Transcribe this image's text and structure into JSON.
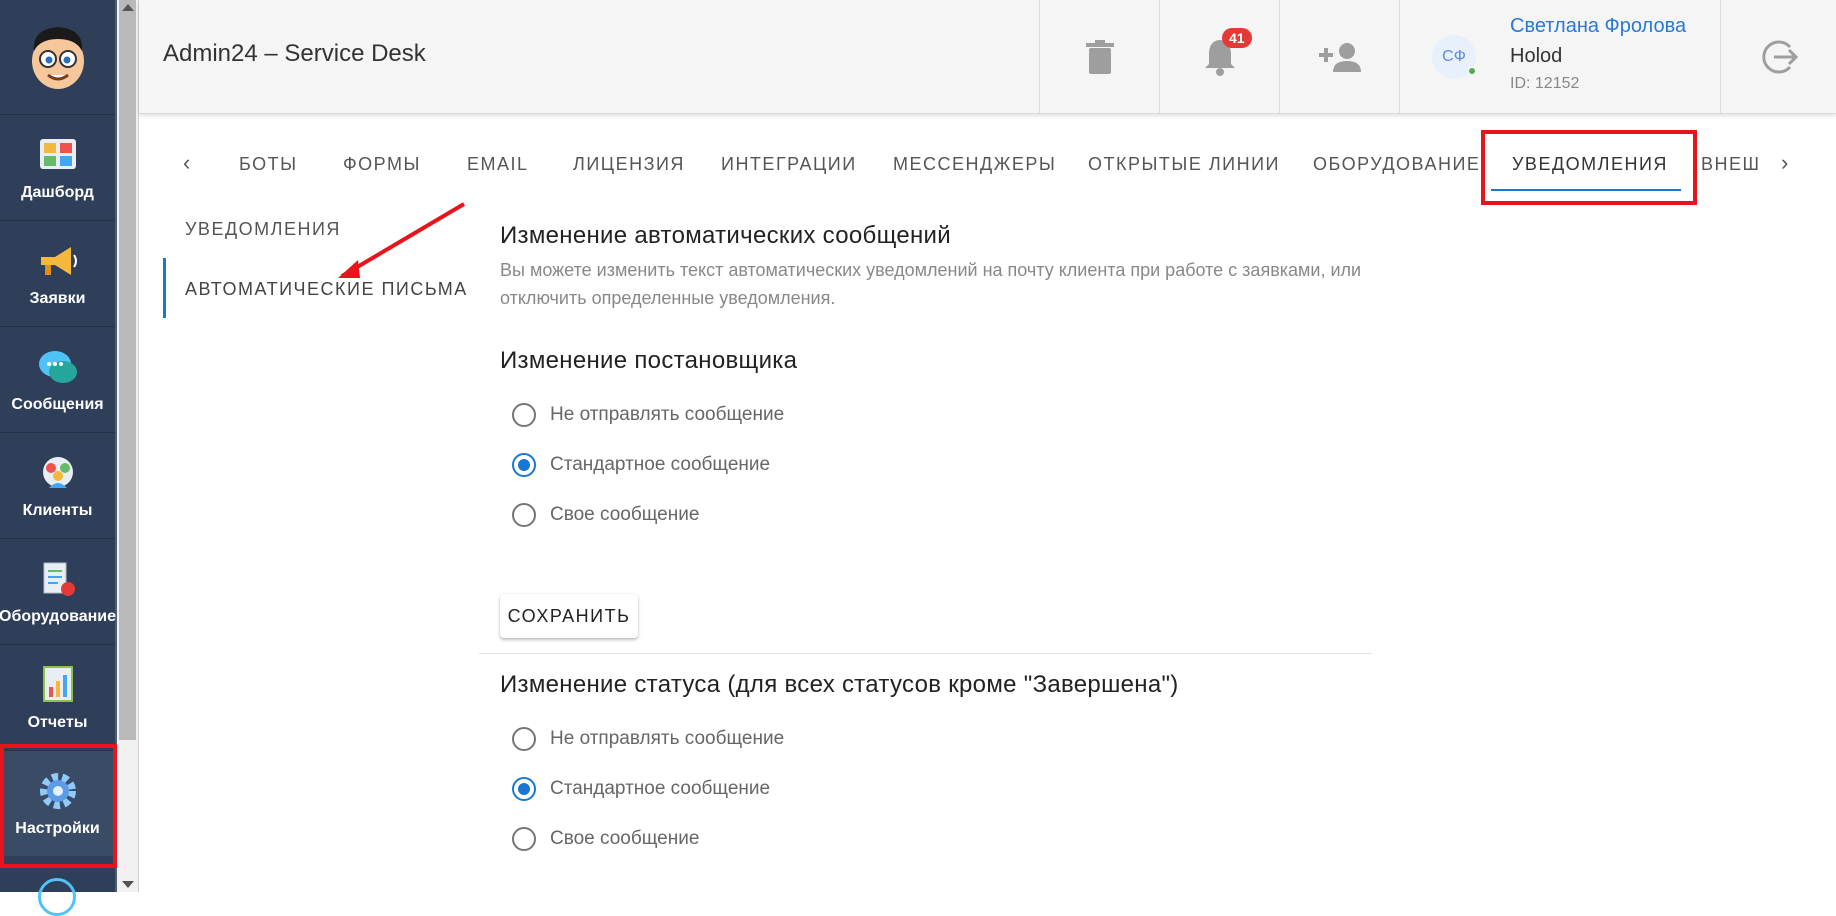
{
  "app": {
    "title": "Admin24 – Service Desk"
  },
  "sidebar": {
    "items": [
      {
        "label": "Дашборд",
        "icon": "dashboard-icon"
      },
      {
        "label": "Заявки",
        "icon": "megaphone-icon"
      },
      {
        "label": "Сообщения",
        "icon": "chat-icon"
      },
      {
        "label": "Клиенты",
        "icon": "clients-icon"
      },
      {
        "label": "Оборудование",
        "icon": "equipment-icon"
      },
      {
        "label": "Отчеты",
        "icon": "reports-icon"
      },
      {
        "label": "Настройки",
        "icon": "gear-icon"
      }
    ]
  },
  "header": {
    "notifications_count": "41",
    "user": {
      "initials": "СФ",
      "name": "Светлана Фролова",
      "company": "Holod",
      "id": "ID: 12152"
    }
  },
  "tabs": [
    "БОТЫ",
    "ФОРМЫ",
    "EMAIL",
    "ЛИЦЕНЗИЯ",
    "ИНТЕГРАЦИИ",
    "МЕССЕНДЖЕРЫ",
    "ОТКРЫТЫЕ ЛИНИИ",
    "ОБОРУДОВАНИЕ",
    "УВЕДОМЛЕНИЯ",
    "ВНЕШ"
  ],
  "subnav": [
    "УВЕДОМЛЕНИЯ",
    "АВТОМАТИЧЕСКИЕ ПИСЬМА"
  ],
  "content": {
    "title": "Изменение автоматических сообщений",
    "description": "Вы можете изменить текст автоматических уведомлений на почту клиента при работе с заявками, или отключить определенные уведомления.",
    "sections": [
      {
        "title": "Изменение постановщика",
        "options": [
          "Не отправлять сообщение",
          "Стандартное сообщение",
          "Свое сообщение"
        ],
        "selected": 1
      },
      {
        "title": "Изменение статуса (для всех статусов кроме \"Завершена\")",
        "options": [
          "Не отправлять сообщение",
          "Стандартное сообщение",
          "Свое сообщение"
        ],
        "selected": 1
      }
    ],
    "save_label": "СОХРАНИТЬ"
  },
  "colors": {
    "accent": "#1976d2",
    "highlight": "#e8141b",
    "sidebar": "#2f3f59"
  }
}
